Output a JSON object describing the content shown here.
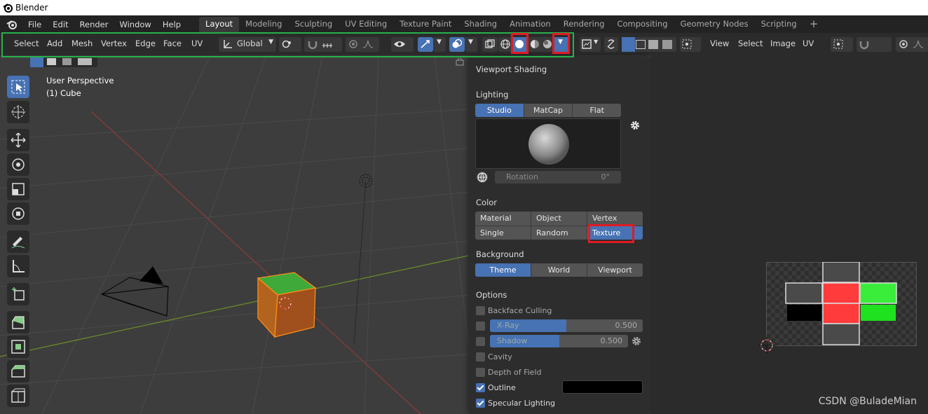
{
  "window": {
    "title": "Blender"
  },
  "menubar": {
    "menus": [
      "File",
      "Edit",
      "Render",
      "Window",
      "Help"
    ],
    "workspaces": [
      "Layout",
      "Modeling",
      "Sculpting",
      "UV Editing",
      "Texture Paint",
      "Shading",
      "Animation",
      "Rendering",
      "Compositing",
      "Geometry Nodes",
      "Scripting"
    ],
    "active_workspace": "Layout",
    "add_workspace": "+"
  },
  "header3d": {
    "menus": [
      "Select",
      "Add",
      "Mesh",
      "Vertex",
      "Edge",
      "Face",
      "UV"
    ],
    "orientation": "Global"
  },
  "header_uv": {
    "menus": [
      "View",
      "Select",
      "Image",
      "UV"
    ]
  },
  "viewport": {
    "perspective": "User Perspective",
    "object": "(1) Cube"
  },
  "shading_panel": {
    "title": "Viewport Shading",
    "lighting": {
      "label": "Lighting",
      "options": [
        "Studio",
        "MatCap",
        "Flat"
      ],
      "selected": "Studio",
      "rotation_label": "Rotation",
      "rotation_value": "0°"
    },
    "color": {
      "label": "Color",
      "options": [
        "Material",
        "Object",
        "Vertex",
        "Single",
        "Random",
        "Texture"
      ],
      "selected": "Texture"
    },
    "background": {
      "label": "Background",
      "options": [
        "Theme",
        "World",
        "Viewport"
      ],
      "selected": "Theme"
    },
    "options": {
      "label": "Options",
      "backface_culling": "Backface Culling",
      "xray": {
        "label": "X-Ray",
        "value": "0.500",
        "fill": 0.5
      },
      "shadow": {
        "label": "Shadow",
        "value": "0.500",
        "fill": 0.5
      },
      "cavity": "Cavity",
      "depth_of_field": "Depth of Field",
      "outline": "Outline",
      "specular": "Specular Lighting"
    }
  },
  "colors": {
    "accent": "#4772b3",
    "highlight_red": "#e01b24",
    "highlight_green": "#27b14c"
  },
  "watermark": "CSDN @BuladeMian"
}
